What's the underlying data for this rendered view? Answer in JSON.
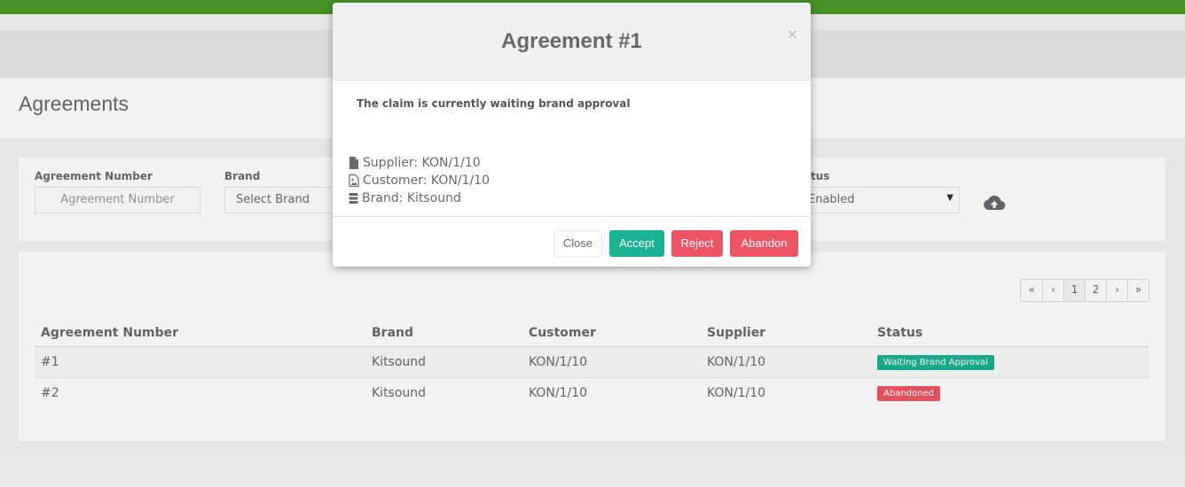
{
  "page": {
    "title": "Agreements"
  },
  "filters": {
    "agreement_number": {
      "label": "Agreement Number",
      "placeholder": "Agreement Number"
    },
    "brand": {
      "label": "Brand",
      "value": "Select Brand"
    },
    "status": {
      "label": "tus",
      "value": "Enabled"
    }
  },
  "pagination": {
    "first": "«",
    "prev": "‹",
    "pages": [
      "1",
      "2"
    ],
    "next": "›",
    "last": "»"
  },
  "table": {
    "headers": [
      "Agreement Number",
      "Brand",
      "Customer",
      "Supplier",
      "Status"
    ],
    "rows": [
      {
        "number": "#1",
        "brand": "Kitsound",
        "customer": "KON/1/10",
        "supplier": "KON/1/10",
        "status": "Waiting Brand Approval",
        "status_color": "#1ab394"
      },
      {
        "number": "#2",
        "brand": "Kitsound",
        "customer": "KON/1/10",
        "supplier": "KON/1/10",
        "status": "Abandoned",
        "status_color": "#ed5565"
      }
    ]
  },
  "modal": {
    "title": "Agreement #1",
    "close_symbol": "×",
    "message": "The claim is currently waiting brand approval",
    "supplier": "Supplier: KON/1/10",
    "customer": "Customer: KON/1/10",
    "brand": "Brand: Kitsound",
    "buttons": {
      "close": "Close",
      "accept": "Accept",
      "reject": "Reject",
      "abandon": "Abandon"
    }
  },
  "colors": {
    "topbar": "#4c9a2a",
    "primary": "#1ab394",
    "danger": "#ed5565"
  }
}
